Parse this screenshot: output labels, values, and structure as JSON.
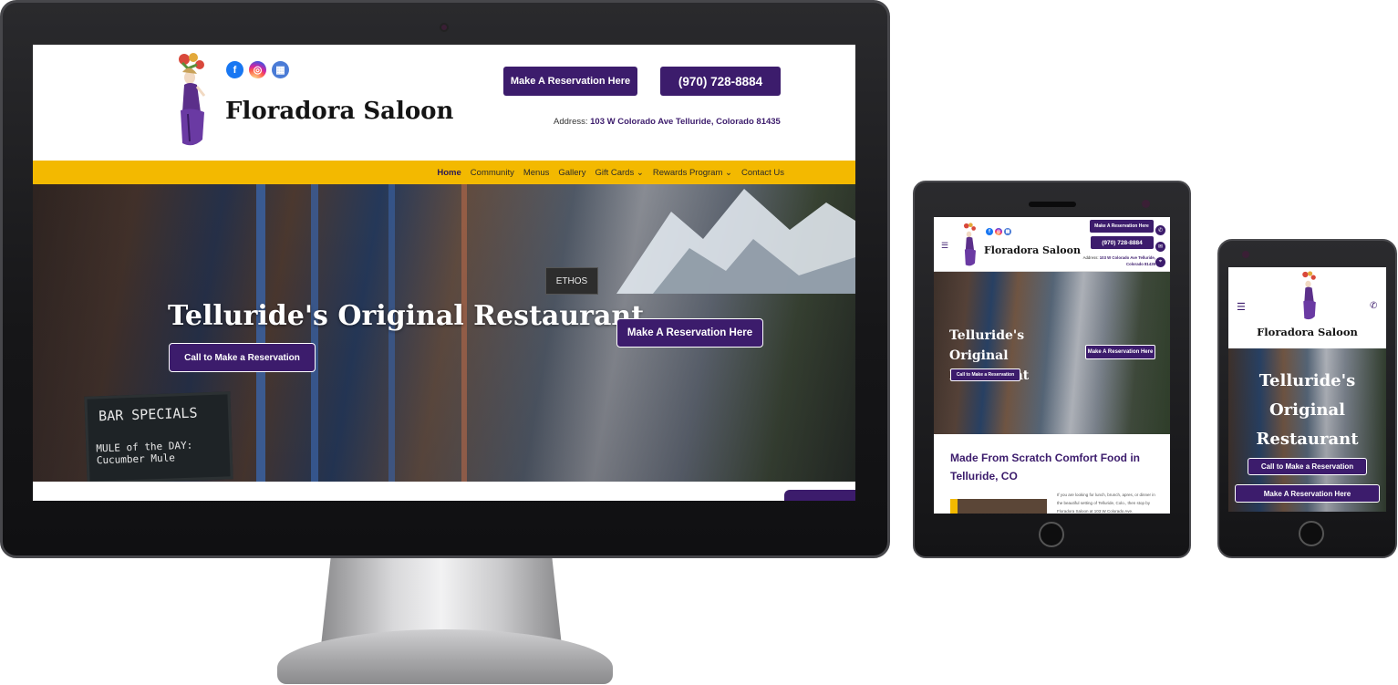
{
  "colors": {
    "brand_purple": "#3c1c6c",
    "nav_gold": "#f3b900",
    "facebook": "#1877f2"
  },
  "brand": {
    "name": "Floradora Saloon"
  },
  "social": [
    {
      "icon": "facebook-icon",
      "glyph": "f"
    },
    {
      "icon": "instagram-icon",
      "glyph": "◎"
    },
    {
      "icon": "opentable-icon",
      "glyph": "▦"
    }
  ],
  "header": {
    "reservation_button": "Make A Reservation Here",
    "phone_button": "(970) 728-8884",
    "address_label": "Address:",
    "address_value": "103 W Colorado Ave Telluride, Colorado 81435"
  },
  "nav": {
    "items": [
      {
        "label": "Home",
        "active": true
      },
      {
        "label": "Community"
      },
      {
        "label": "Menus"
      },
      {
        "label": "Gallery"
      },
      {
        "label": "Gift Cards",
        "dropdown": true
      },
      {
        "label": "Rewards Program",
        "dropdown": true
      },
      {
        "label": "Contact Us"
      }
    ],
    "dropdown_glyph": "⌄"
  },
  "hero": {
    "title": "Telluride's Original Restaurant",
    "call_button": "Call to Make a Reservation",
    "reservation_button": "Make A Reservation Here",
    "sign_bar_specials": "BAR SPECIALS",
    "sign_mule": "MULE of the DAY: Cucumber Mule",
    "sign_ethos": "ETHOS"
  },
  "tablet": {
    "address_label": "Address:",
    "address_value": "103 W Colorado Ave Telluride, Colorado 81435",
    "section_title": "Made From Scratch Comfort Food in Telluride, CO",
    "section_body": "If you are looking for lunch, brunch, apres, or dinner in the beautiful setting of Telluride, Colo., then stop by Floradora Saloon at 103 W Colorado Ave."
  },
  "icons": {
    "menu": "☰",
    "phone": "✆",
    "email": "✉",
    "location": "⌖"
  }
}
